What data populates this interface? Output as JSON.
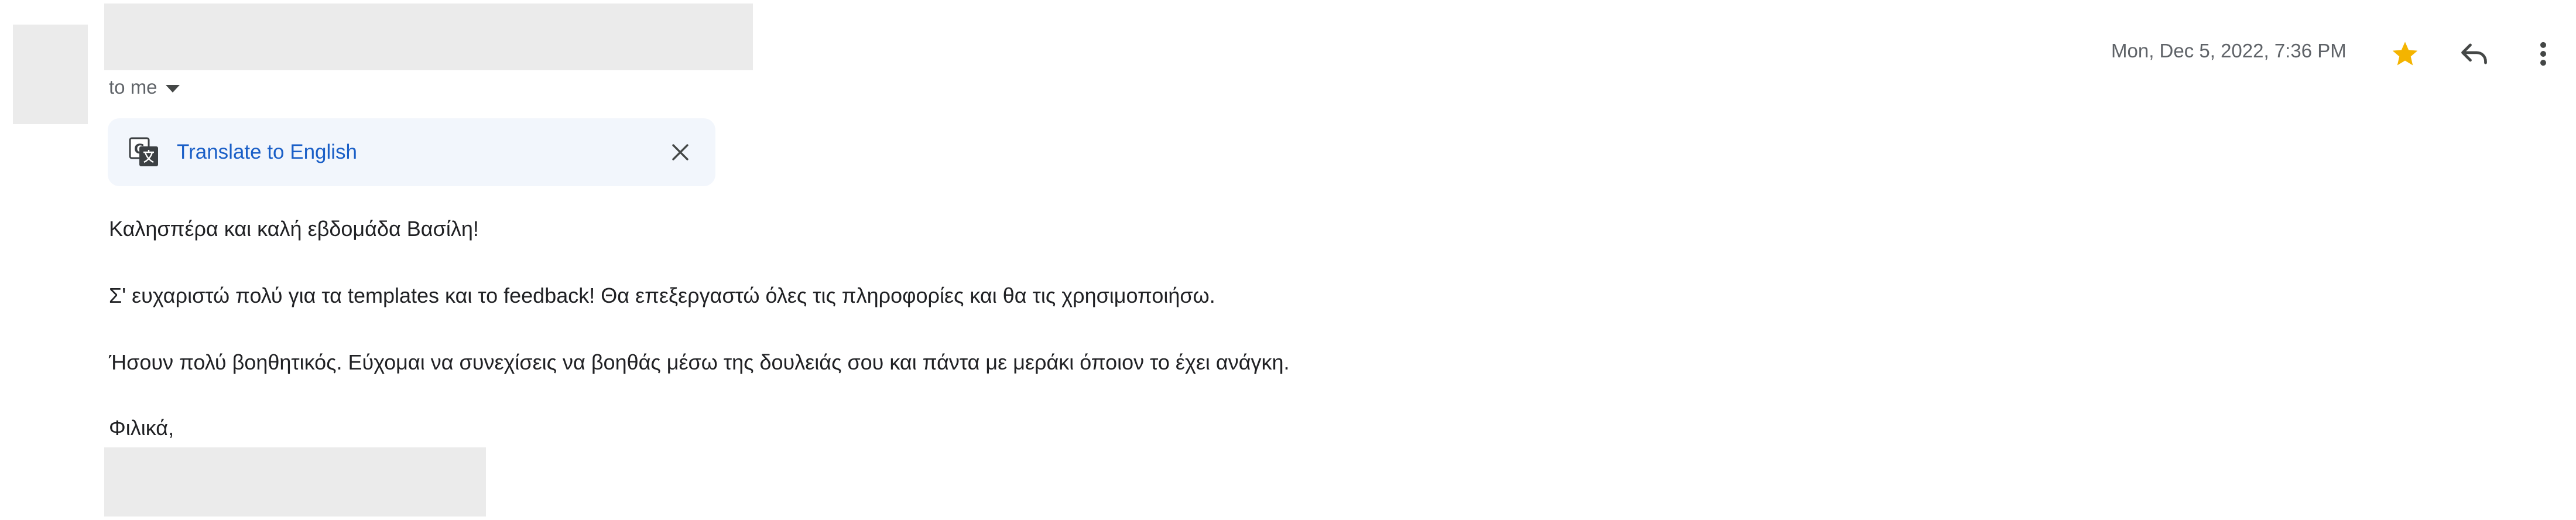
{
  "message": {
    "recipient_label": "to me",
    "timestamp": "Mon, Dec 5, 2022, 7:36 PM",
    "translate": {
      "label": "Translate to English"
    },
    "body": [
      "Καλησπέρα και καλή εβδομάδα Βασίλη!",
      "Σ' ευχαριστώ πολύ για τα templates και το feedback! Θα επεξεργαστώ όλες τις πληροφορίες και θα τις χρησιμοποιήσω.",
      "Ήσουν πολύ βοηθητικός. Εύχομαι να συνεχίσεις να βοηθάς μέσω της δουλειάς σου και πάντα με μεράκι όποιον το έχει ανάγκη.",
      "Φιλικά,"
    ],
    "starred": true
  },
  "icons": {
    "star": "star-icon",
    "reply": "reply-icon",
    "more": "more-vert-icon",
    "translate": "translate-icon",
    "close": "close-icon",
    "dropdown": "chevron-down-icon"
  },
  "colors": {
    "star": "#f4b400",
    "link": "#1a5fc7",
    "translate_bar": "#f2f6fc",
    "redaction": "#ebebeb"
  }
}
